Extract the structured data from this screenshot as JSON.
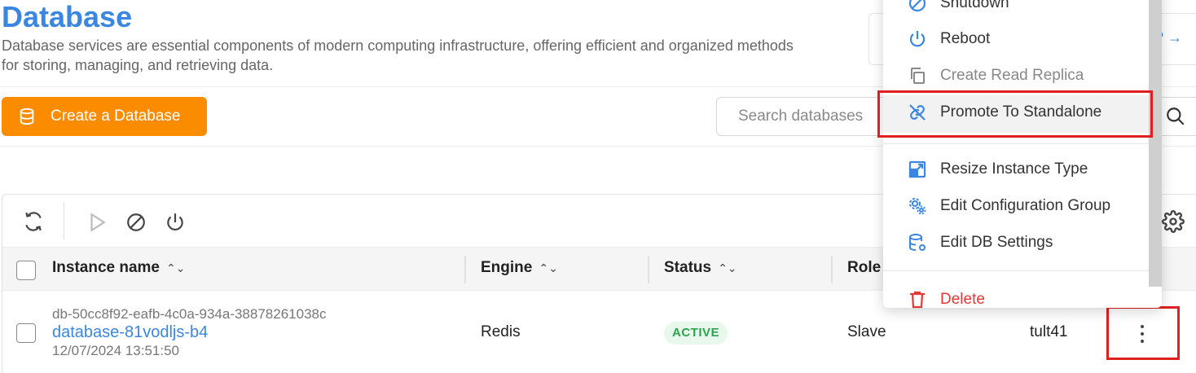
{
  "header": {
    "title": "Database",
    "description": "Database services are essential components of modern computing infrastructure, offering efficient and organized methods for storing, managing, and retrieving data.",
    "help_link": "? →"
  },
  "actions": {
    "create_label": "Create a Database",
    "search_placeholder": "Search databases"
  },
  "table": {
    "columns": [
      {
        "label": "Instance name"
      },
      {
        "label": "Engine"
      },
      {
        "label": "Status"
      },
      {
        "label": "Role"
      }
    ],
    "rows": [
      {
        "instance_id": "db-50cc8f92-eafb-4c0a-934a-38878261038c",
        "instance_name": "database-81vodljs-b4",
        "created": "12/07/2024 13:51:50",
        "engine": "Redis",
        "status": "ACTIVE",
        "role": "Slave",
        "extra": "tult41"
      }
    ]
  },
  "menu": {
    "items": [
      {
        "label": "Shutdown",
        "icon": "ban-icon",
        "state": "normal"
      },
      {
        "label": "Reboot",
        "icon": "power-icon",
        "state": "normal"
      },
      {
        "label": "Create Read Replica",
        "icon": "copy-icon",
        "state": "disabled"
      },
      {
        "label": "Promote To Standalone",
        "icon": "unlink-icon",
        "state": "hover"
      },
      {
        "label": "Resize Instance Type",
        "icon": "resize-icon",
        "state": "normal"
      },
      {
        "label": "Edit Configuration Group",
        "icon": "gears-icon",
        "state": "normal"
      },
      {
        "label": "Edit DB Settings",
        "icon": "database-settings-icon",
        "state": "normal"
      },
      {
        "label": "Delete",
        "icon": "trash-icon",
        "state": "danger"
      }
    ]
  },
  "colors": {
    "accent": "#3a86e0",
    "primary_button": "#fb8c00",
    "status_active_bg": "#e8f8ec",
    "status_active_text": "#2ca44c",
    "danger": "#e53935",
    "highlight": "#e02020"
  }
}
